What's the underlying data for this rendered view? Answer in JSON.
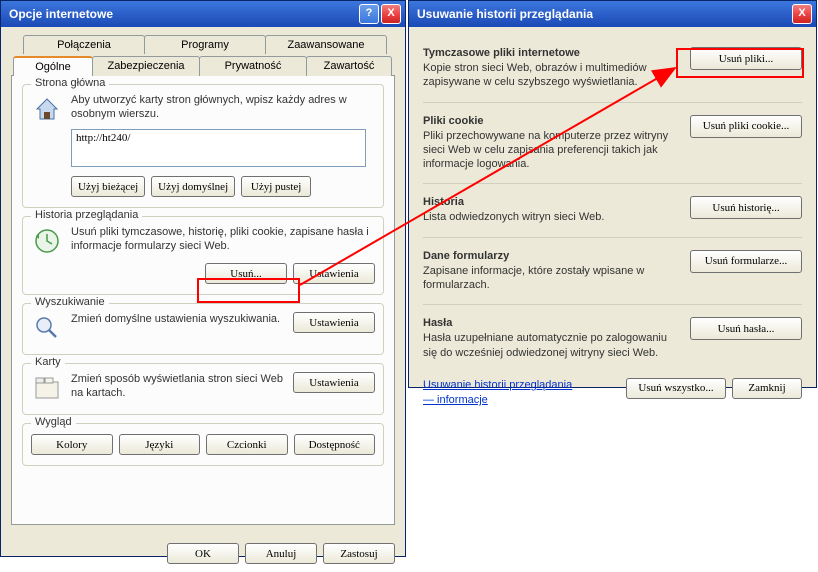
{
  "dialogLeft": {
    "title": "Opcje internetowe",
    "tabs": {
      "row1": [
        "Połączenia",
        "Programy",
        "Zaawansowane"
      ],
      "row2": [
        "Ogólne",
        "Zabezpieczenia",
        "Prywatność",
        "Zawartość"
      ]
    },
    "homepage": {
      "legend": "Strona główna",
      "text": "Aby utworzyć karty stron głównych, wpisz każdy adres w osobnym wierszu.",
      "value": "http://ht240/",
      "btnCurrent": "Użyj bieżącej",
      "btnDefault": "Użyj domyślnej",
      "btnBlank": "Użyj pustej"
    },
    "history": {
      "legend": "Historia przeglądania",
      "text": "Usuń pliki tymczasowe, historię, pliki cookie, zapisane hasła i informacje formularzy sieci Web.",
      "btnDelete": "Usuń...",
      "btnSettings": "Ustawienia"
    },
    "search": {
      "legend": "Wyszukiwanie",
      "text": "Zmień domyślne ustawienia wyszukiwania.",
      "btnSettings": "Ustawienia"
    },
    "tabsCards": {
      "legend": "Karty",
      "text": "Zmień sposób wyświetlania stron sieci Web na kartach.",
      "btnSettings": "Ustawienia"
    },
    "appearance": {
      "legend": "Wygląd",
      "btnColors": "Kolory",
      "btnLanguages": "Języki",
      "btnFonts": "Czcionki",
      "btnAccessibility": "Dostępność"
    },
    "bottom": {
      "ok": "OK",
      "cancel": "Anuluj",
      "apply": "Zastosuj"
    }
  },
  "dialogRight": {
    "title": "Usuwanie historii przeglądania",
    "sections": {
      "tempFiles": {
        "title": "Tymczasowe pliki internetowe",
        "desc": "Kopie stron sieci Web, obrazów i multimediów zapisywane w celu szybszego wyświetlania.",
        "btn": "Usuń pliki..."
      },
      "cookies": {
        "title": "Pliki cookie",
        "desc": "Pliki przechowywane na komputerze przez witryny sieci Web w celu zapisania preferencji takich jak informacje logowania.",
        "btn": "Usuń pliki cookie..."
      },
      "historia": {
        "title": "Historia",
        "desc": "Lista odwiedzonych witryn sieci Web.",
        "btn": "Usuń historię..."
      },
      "forms": {
        "title": "Dane formularzy",
        "desc": "Zapisane informacje, które zostały wpisane w formularzach.",
        "btn": "Usuń formularze..."
      },
      "passwords": {
        "title": "Hasła",
        "desc": "Hasła uzupełniane automatycznie po zalogowaniu się do wcześniej odwiedzonej witryny sieci Web.",
        "btn": "Usuń hasła..."
      }
    },
    "footer": {
      "link1": "Usuwanie historii przeglądania",
      "link2": "— informacje",
      "btnAll": "Usuń wszystko...",
      "btnClose": "Zamknij"
    }
  }
}
